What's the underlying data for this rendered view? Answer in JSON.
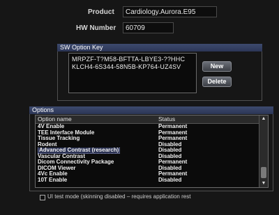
{
  "product": {
    "label": "Product",
    "value": "Cardiology.Aurora.E95"
  },
  "hw_number": {
    "label": "HW Number",
    "value": "60709"
  },
  "sw_option_key": {
    "title": "SW Option Key",
    "keys": [
      "MRPZF-T?M58-BFTTA-LBYE3-??HHC",
      "KLCH4-6S344-58N5B-KP764-UZ4SV"
    ],
    "new_label": "New",
    "delete_label": "Delete"
  },
  "options": {
    "title": "Options",
    "columns": [
      "Option name",
      "Status"
    ],
    "rows": [
      {
        "name": "4V Enable",
        "status": "Permanent"
      },
      {
        "name": "TEE Interface Module",
        "status": "Permanent"
      },
      {
        "name": "Tissue Tracking",
        "status": "Permanent"
      },
      {
        "name": "Rodent",
        "status": "Disabled"
      },
      {
        "name": "Advanced Contrast (research)",
        "status": "Disabled",
        "selected": true
      },
      {
        "name": "Vascular Contrast",
        "status": "Disabled"
      },
      {
        "name": "Dicom Connectivity Package",
        "status": "Permanent"
      },
      {
        "name": "DICOM Viewer",
        "status": "Disabled"
      },
      {
        "name": "4Vc Enable",
        "status": "Permanent"
      },
      {
        "name": "10T Enable",
        "status": "Disabled"
      }
    ]
  },
  "ui_test_mode": {
    "label": "UI test mode (skinning disabled – requires application rest",
    "checked": false
  },
  "icons": {
    "scroll_up": "triangle-up-icon",
    "scroll_down": "triangle-down-icon"
  }
}
